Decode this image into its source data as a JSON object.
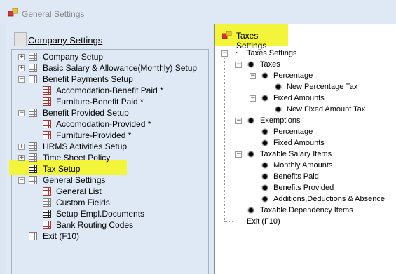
{
  "window": {
    "title": "General Settings",
    "icon": "app-icon"
  },
  "left": {
    "header_label": "Company Settings",
    "items": [
      {
        "label": "Company Setup",
        "expander": "+",
        "icon": "grid-icon"
      },
      {
        "label": "Basic Salary & Allowance(Monthly) Setup",
        "expander": "+",
        "icon": "grid-icon"
      },
      {
        "label": "Benefit Payments Setup",
        "expander": "−",
        "icon": "grid-icon"
      },
      {
        "label": "Accomodation-Benefit Paid *",
        "icon": "grid-red-icon"
      },
      {
        "label": "Furniture-Benefit Paid *",
        "icon": "grid-red-icon"
      },
      {
        "label": "Benefit Provided Setup",
        "expander": "−",
        "icon": "grid-icon"
      },
      {
        "label": "Accomodation-Provided *",
        "icon": "grid-red-icon"
      },
      {
        "label": "Furniture-Provided *",
        "icon": "grid-red-icon"
      },
      {
        "label": "HRMS Activities Setup",
        "expander": "+",
        "icon": "grid-icon"
      },
      {
        "label": "Time Sheet Policy",
        "expander": "+",
        "icon": "grid-icon"
      },
      {
        "label": "Tax Setup",
        "icon": "grid-dark-icon",
        "highlighted": true
      },
      {
        "label": "General Settings",
        "expander": "−",
        "icon": "grid-icon"
      },
      {
        "label": "General List",
        "icon": "grid-red-icon"
      },
      {
        "label": "Custom Fields",
        "icon": "grid-icon"
      },
      {
        "label": "Setup Empl.Documents",
        "icon": "grid-dark-icon"
      },
      {
        "label": "Bank Routing Codes",
        "icon": "grid-red-icon"
      },
      {
        "label": "Exit (F10)",
        "icon": "grid-icon"
      }
    ]
  },
  "right": {
    "header_label": "Taxes Settings",
    "items": [
      {
        "label": "Taxes Settings"
      },
      {
        "label": "Taxes"
      },
      {
        "label": "Percentage"
      },
      {
        "label": "New Percentage Tax"
      },
      {
        "label": "Fixed Amounts"
      },
      {
        "label": "New Fixed Amount Tax"
      },
      {
        "label": "Exemptions"
      },
      {
        "label": "Percentage"
      },
      {
        "label": "Fixed Amounts"
      },
      {
        "label": "Taxable Salary Items"
      },
      {
        "label": "Monthly Amounts"
      },
      {
        "label": "Benefits Paid"
      },
      {
        "label": "Benefits Provided"
      },
      {
        "label": "Additions,Deductions & Absence"
      },
      {
        "label": "Taxable Dependency Items"
      },
      {
        "label": "Exit (F10)"
      }
    ]
  },
  "colors": {
    "highlight": "#f2f53a",
    "pane_bg": "#dfe9f5"
  }
}
